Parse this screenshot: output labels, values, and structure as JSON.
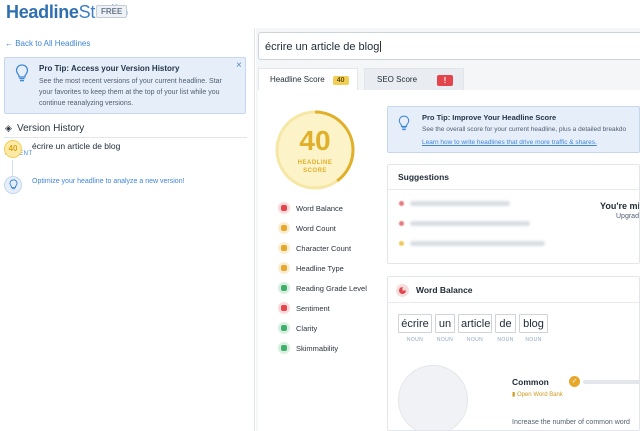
{
  "app": {
    "logo_bold": "Headline",
    "logo_light": "Studio",
    "plan_badge": "FREE"
  },
  "left_panel": {
    "back_link": "← Back to All Headlines",
    "tip": {
      "title": "Pro Tip: Access your Version History",
      "body": "See the most recent versions of your current headline. Star your favorites to keep them at the top of your list while you continue reanalyzing versions.",
      "close": "×"
    },
    "version_history_title": "Version History",
    "recent_label": "RECENT",
    "history_items": [
      {
        "score": "40",
        "title": "écrire un article de blog"
      }
    ],
    "optimize_link": "Optimize your headline to analyze a new version!"
  },
  "headline_input": {
    "value": "écrire un article de blog"
  },
  "tabs": [
    {
      "label": "Headline Score",
      "badge": "40"
    },
    {
      "label": "SEO Score",
      "badge": "!"
    }
  ],
  "score": {
    "value": "40",
    "caption_line1": "HEADLINE",
    "caption_line2": "SCORE",
    "fraction": 0.4,
    "color": "#e0b02a"
  },
  "metrics": [
    {
      "label": "Word Balance",
      "icon": "word-balance-icon",
      "color": "#e2454b"
    },
    {
      "label": "Word Count",
      "icon": "word-count-icon",
      "color": "#e6a72a"
    },
    {
      "label": "Character Count",
      "icon": "character-count-icon",
      "color": "#e6a72a"
    },
    {
      "label": "Headline Type",
      "icon": "headline-type-icon",
      "color": "#e6a72a"
    },
    {
      "label": "Reading Grade Level",
      "icon": "reading-grade-icon",
      "color": "#3fb06a"
    },
    {
      "label": "Sentiment",
      "icon": "sentiment-icon",
      "color": "#e2454b"
    },
    {
      "label": "Clarity",
      "icon": "clarity-icon",
      "color": "#3fb06a"
    },
    {
      "label": "Skimmability",
      "icon": "skimmability-icon",
      "color": "#3fb06a"
    }
  ],
  "pro_tip_right": {
    "title": "Pro Tip: Improve Your Headline Score",
    "body": "See the overall score for your current headline, plus a detailed breakdo",
    "link": "Learn how to write headlines that drive more traffic & shares."
  },
  "suggestions": {
    "title": "Suggestions",
    "missing_text": "You're mi",
    "upgrade_text": "Upgrad"
  },
  "word_balance": {
    "title": "Word Balance",
    "words": [
      {
        "word": "écrire",
        "tag": "NOUN"
      },
      {
        "word": "un",
        "tag": "NOUN"
      },
      {
        "word": "article",
        "tag": "NOUN"
      },
      {
        "word": "de",
        "tag": "NOUN"
      },
      {
        "word": "blog",
        "tag": "NOUN"
      }
    ],
    "common_label": "Common",
    "word_bank_link": "Open Word Bank",
    "increase_text": "Increase the number of common word"
  }
}
